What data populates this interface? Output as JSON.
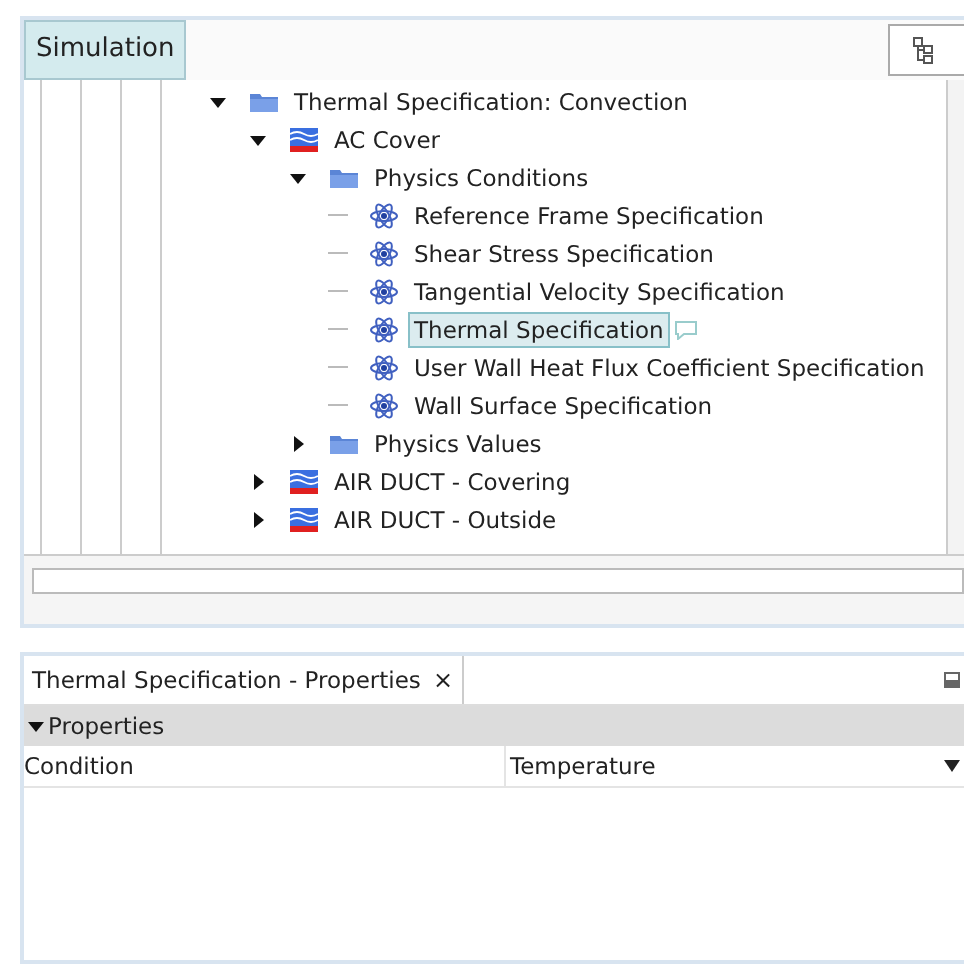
{
  "toolbar": {
    "tab": {
      "label": "Simulation",
      "selected": true
    }
  },
  "tree": [
    {
      "label": "Thermal Specification: Convection",
      "kind": "folder",
      "expanded": true,
      "children": [
        {
          "label": "AC Cover",
          "kind": "region",
          "expanded": true,
          "children": [
            {
              "label": "Physics Conditions",
              "kind": "folder",
              "expanded": true,
              "children": [
                {
                  "label": "Reference Frame Specification",
                  "kind": "condition",
                  "selected": false
                },
                {
                  "label": "Shear Stress Specification",
                  "kind": "condition",
                  "selected": false
                },
                {
                  "label": "Tangential Velocity Specification",
                  "kind": "condition",
                  "selected": false
                },
                {
                  "label": "Thermal Specification",
                  "kind": "condition",
                  "selected": true,
                  "comment": true
                },
                {
                  "label": "User Wall Heat Flux Coefficient Specification",
                  "kind": "condition",
                  "selected": false
                },
                {
                  "label": "Wall Surface Specification",
                  "kind": "condition",
                  "selected": false
                }
              ]
            },
            {
              "label": "Physics Values",
              "kind": "folder",
              "expanded": false
            }
          ]
        },
        {
          "label": "AIR DUCT - Covering",
          "kind": "region",
          "expanded": false
        },
        {
          "label": "AIR DUCT - Outside",
          "kind": "region",
          "expanded": false
        }
      ]
    }
  ],
  "properties_panel": {
    "tab": {
      "label": "Thermal Specification - Properties",
      "close": "×"
    },
    "section": {
      "label": "Properties",
      "expanded": true
    },
    "rows": [
      {
        "name": "Condition",
        "value": "Temperature"
      }
    ]
  }
}
